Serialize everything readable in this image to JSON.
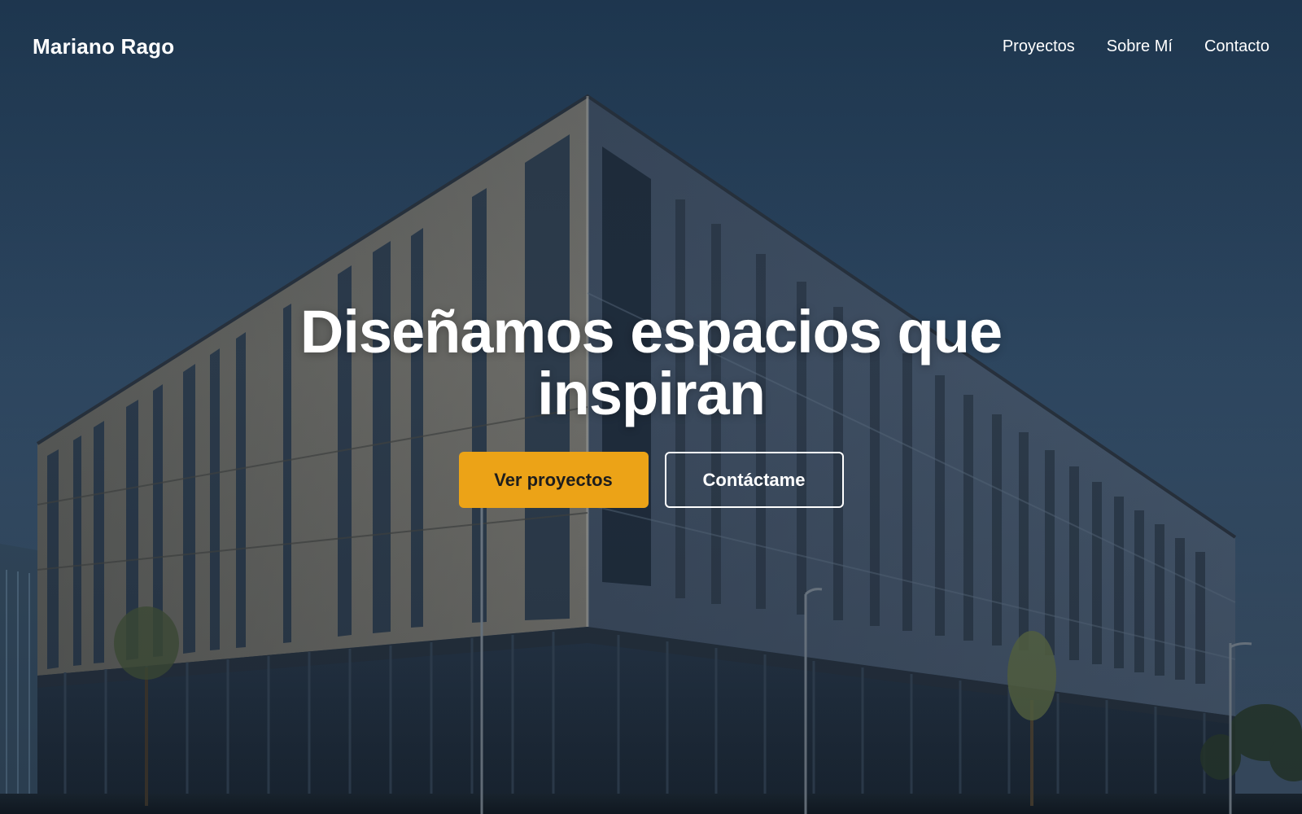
{
  "brand": {
    "name": "Mariano Rago"
  },
  "nav": {
    "items": [
      {
        "label": "Proyectos"
      },
      {
        "label": "Sobre Mí"
      },
      {
        "label": "Contacto"
      }
    ]
  },
  "hero": {
    "headline_line1": "Diseñamos espacios que",
    "headline_line2": "inspiran",
    "primary_cta": "Ver proyectos",
    "secondary_cta": "Contáctame"
  },
  "colors": {
    "accent": "#eca317",
    "sky_top": "#1f3d5c",
    "text": "#ffffff"
  }
}
